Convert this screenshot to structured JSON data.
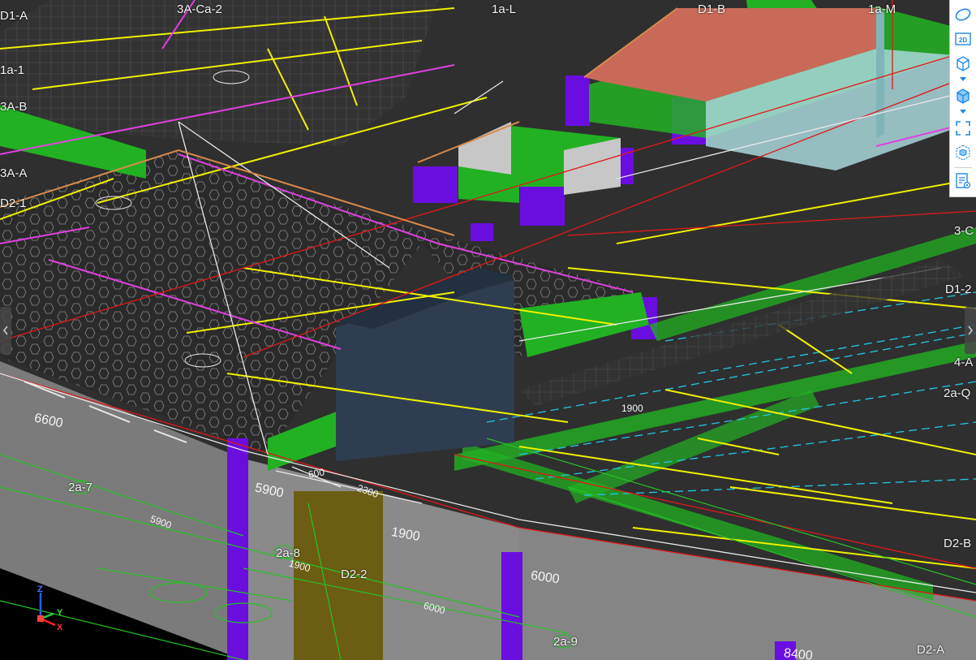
{
  "grid_labels": [
    "D1-A",
    "3A-Ca-2",
    "1a-L",
    "D1-B",
    "1a-M",
    "1a-1",
    "3A-B",
    "3A-A",
    "D2-1",
    "3-C",
    "D1-2",
    "4-A",
    "2a-Q",
    "D2-B",
    "2a-7",
    "2a-8",
    "D2-2",
    "2a-9",
    "D2-A"
  ],
  "dimensions": [
    "6600",
    "5900",
    "5900",
    "1900",
    "1900",
    "6000",
    "6000",
    "8400",
    "1900",
    "2300",
    "600"
  ],
  "toolbar": {
    "buttons": [
      "orbit",
      "2D",
      "perspective-box",
      "box-view",
      "fit-view",
      "model-view",
      "properties"
    ],
    "label_2d": "2D"
  },
  "axis": {
    "x": "X",
    "y": "Y",
    "z": "Z"
  },
  "colors": {
    "background": "#2f2f2f",
    "beam_green": "#22b122",
    "column_purple": "#6a0ee0",
    "line_yellow": "#f0f000",
    "line_magenta": "#e040e0",
    "line_cyan": "#20c8e8",
    "line_red": "#e01818",
    "wall_gray": "#8a8a8a",
    "block_navy": "#2e3e50",
    "toolbar_icon": "#1e88e5"
  }
}
